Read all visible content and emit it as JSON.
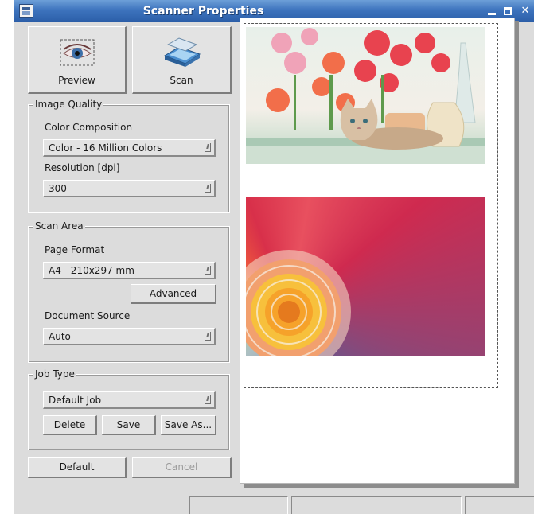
{
  "window": {
    "title": "Scanner Properties"
  },
  "toolbar": {
    "preview_label": "Preview",
    "scan_label": "Scan"
  },
  "image_quality": {
    "title": "Image Quality",
    "color_label": "Color Composition",
    "color_value": "Color - 16 Million Colors",
    "resolution_label": "Resolution [dpi]",
    "resolution_value": "300"
  },
  "scan_area": {
    "title": "Scan Area",
    "page_format_label": "Page Format",
    "page_format_value": "A4 - 210x297 mm",
    "advanced_label": "Advanced",
    "document_source_label": "Document Source",
    "document_source_value": "Auto"
  },
  "job_type": {
    "title": "Job Type",
    "value": "Default Job",
    "delete_label": "Delete",
    "save_label": "Save",
    "save_as_label": "Save As..."
  },
  "footer": {
    "default_label": "Default",
    "cancel_label": "Cancel"
  },
  "icons": {
    "window": "scanner-app-icon",
    "preview": "eye-preview-icon",
    "scan": "flatbed-scanner-icon"
  },
  "colors": {
    "titlebar": "#3d73bd",
    "background": "#dcdcdc"
  }
}
